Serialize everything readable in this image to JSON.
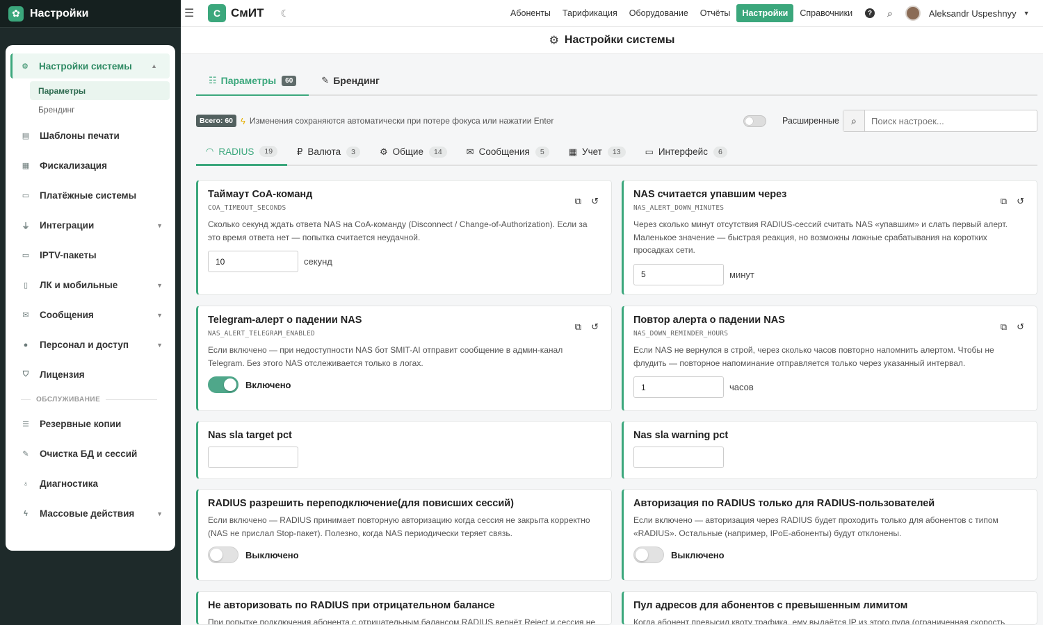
{
  "sidebar": {
    "title": "Настройки",
    "items": [
      {
        "label": "Настройки системы",
        "icon": "cogs-icon",
        "caret": "▲",
        "active": true
      },
      {
        "label": "Шаблоны печати",
        "icon": "printer-icon"
      },
      {
        "label": "Фискализация",
        "icon": "cash-register-icon"
      },
      {
        "label": "Платёжные системы",
        "icon": "credit-card-icon"
      },
      {
        "label": "Интеграции",
        "icon": "plug-icon",
        "caret": "▼"
      },
      {
        "label": "IPTV-пакеты",
        "icon": "tv-icon"
      },
      {
        "label": "ЛК и мобильные",
        "icon": "mobile-icon",
        "caret": "▼"
      },
      {
        "label": "Сообщения",
        "icon": "envelope-icon",
        "caret": "▼"
      },
      {
        "label": "Персонал и доступ",
        "icon": "users-icon",
        "caret": "▼"
      },
      {
        "label": "Лицензия",
        "icon": "shield-icon"
      },
      {
        "label": "Резервные копии",
        "icon": "database-icon"
      },
      {
        "label": "Очистка БД и сессий",
        "icon": "broom-icon"
      },
      {
        "label": "Диагностика",
        "icon": "stethoscope-icon"
      },
      {
        "label": "Массовые действия",
        "icon": "bolt-icon",
        "caret": "▼"
      }
    ],
    "subitems": [
      "Параметры",
      "Брендинг"
    ],
    "section_label": "ОБСЛУЖИВАНИЕ"
  },
  "topbar": {
    "brand_letter": "С",
    "brand": "СмИТ",
    "nav": [
      "Абоненты",
      "Тарификация",
      "Оборудование",
      "Отчёты",
      "Настройки",
      "Справочники"
    ],
    "active_nav": "Настройки",
    "help": "?",
    "user": "Aleksandr Uspeshnyy"
  },
  "page": {
    "title": "Настройки системы"
  },
  "main_tabs": [
    {
      "label": "Параметры",
      "badge": "60"
    },
    {
      "label": "Брендинг"
    }
  ],
  "info": {
    "total": "Всего: 60",
    "hint": "Изменения сохраняются автоматически при потере фокуса или нажатии Enter",
    "advanced_label": "Расширенные",
    "search_placeholder": "Поиск настроек..."
  },
  "sub_tabs": [
    {
      "label": "RADIUS",
      "count": "19",
      "icon": "wifi-icon"
    },
    {
      "label": "Валюта",
      "count": "3",
      "icon": "ruble-icon"
    },
    {
      "label": "Общие",
      "count": "14",
      "icon": "cogs-icon"
    },
    {
      "label": "Сообщения",
      "count": "5",
      "icon": "envelope-icon"
    },
    {
      "label": "Учет",
      "count": "13",
      "icon": "calculator-icon"
    },
    {
      "label": "Интерфейс",
      "count": "6",
      "icon": "monitor-icon"
    }
  ],
  "cards": [
    {
      "title": "Таймаут CoA-команд",
      "key": "COA_TIMEOUT_SECONDS",
      "desc": "Сколько секунд ждать ответа NAS на CoA-команду (Disconnect / Change-of-Authorization). Если за это время ответа нет — попытка считается неудачной.",
      "value": "10",
      "unit": "секунд"
    },
    {
      "title": "NAS считается упавшим через",
      "key": "NAS_ALERT_DOWN_MINUTES",
      "desc": "Через сколько минут отсутствия RADIUS-сессий считать NAS «упавшим» и слать первый алерт. Маленькое значение — быстрая реакция, но возможны ложные срабатывания на коротких просадках сети.",
      "value": "5",
      "unit": "минут"
    },
    {
      "title": "Telegram-алерт о падении NAS",
      "key": "NAS_ALERT_TELEGRAM_ENABLED",
      "desc": "Если включено — при недоступности NAS бот SMIT-AI отправит сообщение в админ-канал Telegram. Без этого NAS отслеживается только в логах.",
      "toggle": true,
      "state_label": "Включено"
    },
    {
      "title": "Повтор алерта о падении NAS",
      "key": "NAS_DOWN_REMINDER_HOURS",
      "desc": "Если NAS не вернулся в строй, через сколько часов повторно напомнить алертом. Чтобы не флудить — повторное напоминание отправляется только через указанный интервал.",
      "value": "1",
      "unit": "часов"
    },
    {
      "title": "Nas sla target pct",
      "value": ""
    },
    {
      "title": "Nas sla warning pct",
      "value": ""
    },
    {
      "title": "RADIUS разрешить переподключение(для повисших сессий)",
      "desc": "Если включено — RADIUS принимает повторную авторизацию когда сессия не закрыта корректно (NAS не прислал Stop-пакет). Полезно, когда NAS периодически теряет связь.",
      "toggle": false,
      "state_label": "Выключено"
    },
    {
      "title": "Авторизация по RADIUS только для RADIUS-пользователей",
      "desc": "Если включено — авторизация через RADIUS будет проходить только для абонентов с типом «RADIUS». Остальные (например, IPoE-абоненты) будут отклонены.",
      "toggle": false,
      "state_label": "Выключено"
    },
    {
      "title": "Не авторизовать по RADIUS при отрицательном балансе",
      "desc": "При попытке подключения абонента с отрицательным балансом RADIUS вернёт Reject и сессия не"
    },
    {
      "title": "Пул адресов для абонентов с превышенным лимитом",
      "desc": "Когда абонент превысил квоту трафика, ему выдаётся IP из этого пула (ограниченная скорость"
    }
  ],
  "colors": {
    "accent": "#3ba77c",
    "sidebar_bg": "#1e2a2a"
  }
}
